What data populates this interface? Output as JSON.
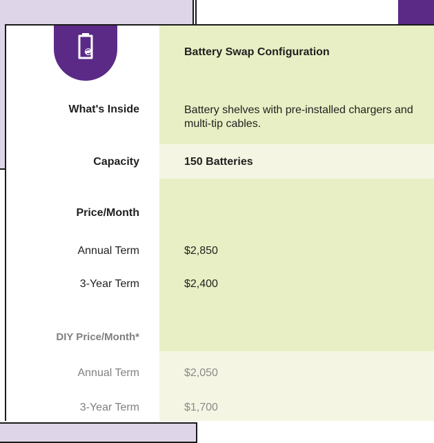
{
  "colors": {
    "accent_purple": "#5b2a86",
    "lavender_bg": "#ded5e8",
    "column_green": "#e9efc4",
    "column_light_green": "#f4f6e3"
  },
  "header": {
    "icon": "battery-swap-icon",
    "title": "Battery Swap Configuration"
  },
  "rows": {
    "inside_label": "What's Inside",
    "inside_value": "Battery shelves with pre-installed chargers and multi-tip cables.",
    "capacity_label": "Capacity",
    "capacity_value": "150 Batteries",
    "price_label": "Price/Month",
    "annual_label": "Annual Term",
    "annual_value": "$2,850",
    "three_year_label": "3-Year Term",
    "three_year_value": "$2,400",
    "diy_label": "DIY Price/Month*",
    "diy_annual_label": "Annual Term",
    "diy_annual_value": "$2,050",
    "diy_three_year_label": "3-Year Term",
    "diy_three_year_value": "$1,700"
  }
}
